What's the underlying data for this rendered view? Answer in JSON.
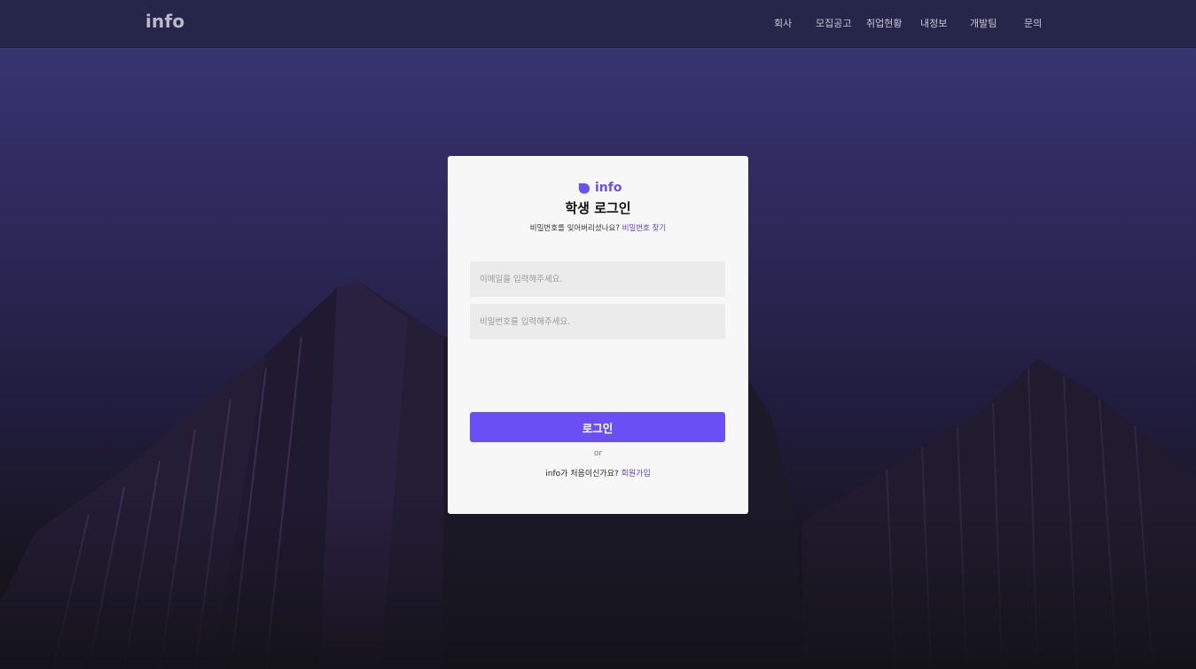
{
  "header": {
    "logo": "info",
    "nav": [
      "회사",
      "모집공고",
      "취업현황",
      "내정보",
      "개발팀",
      "문의"
    ]
  },
  "login_card": {
    "brand": "info",
    "title": "학생 로그인",
    "forgot_prompt": "비밀번호를 잊어버리셨나요?",
    "forgot_link": "비밀번호 찾기",
    "email_placeholder": "이메일을 입력해주세요.",
    "password_placeholder": "비밀번호를 입력해주세요.",
    "login_button": "로그인",
    "divider": "or",
    "signup_prompt": "info가 처음이신가요?",
    "signup_link": "회원가입"
  },
  "colors": {
    "accent": "#6a4ff5",
    "header_bg": "#26264a",
    "card_bg": "#f7f7f7",
    "field_bg": "#ebebeb"
  },
  "icons": {
    "brand": "info-logo-icon"
  }
}
